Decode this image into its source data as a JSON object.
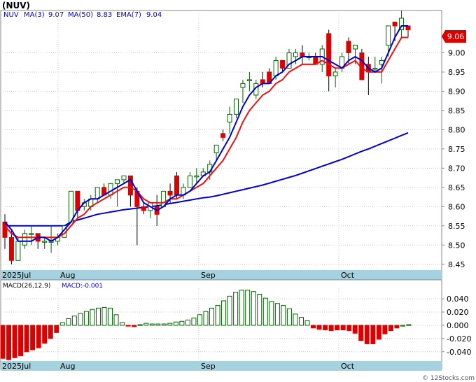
{
  "title": "(NUV)",
  "indicators": {
    "ticker": "NUV",
    "ma3_label": "MA(3)",
    "ma3_value": "9.07",
    "ma50_label": "MA(50)",
    "ma50_value": "8.83",
    "ema7_label": "EMA(7)",
    "ema7_value": "9.04"
  },
  "macd_header": {
    "label": "MACD(26,12,9)",
    "value_label": "MACD:-0.001"
  },
  "price_tag": "9.06",
  "watermark": "© 12Stocks.com",
  "colors": {
    "up": "#006400",
    "down": "#dd0000",
    "ma": "#0000cc",
    "ema": "#ee1111",
    "axis_band": "#a6d1de",
    "tag": "#dd0000"
  },
  "chart_data": [
    {
      "type": "candlestick",
      "x_labels": [
        "2025Jul",
        "Aug",
        "Sep",
        "Oct"
      ],
      "y_ticks": [
        "9.00",
        "8.95",
        "8.90",
        "8.85",
        "8.80",
        "8.75",
        "8.70",
        "8.65",
        "8.60",
        "8.55",
        "8.50",
        "8.45"
      ],
      "ylim": [
        8.435,
        9.11
      ],
      "candles": [
        [
          8.56,
          8.58,
          8.49,
          8.52
        ],
        [
          8.52,
          8.54,
          8.45,
          8.46
        ],
        [
          8.46,
          8.52,
          8.46,
          8.51
        ],
        [
          8.5,
          8.54,
          8.49,
          8.53
        ],
        [
          8.53,
          8.55,
          8.5,
          8.53
        ],
        [
          8.53,
          8.53,
          8.49,
          8.51
        ],
        [
          8.51,
          8.52,
          8.49,
          8.51
        ],
        [
          8.51,
          8.55,
          8.48,
          8.51
        ],
        [
          8.51,
          8.53,
          8.5,
          8.52
        ],
        [
          8.52,
          8.55,
          8.52,
          8.55
        ],
        [
          8.56,
          8.64,
          8.56,
          8.64
        ],
        [
          8.64,
          8.64,
          8.57,
          8.59
        ],
        [
          8.6,
          8.62,
          8.59,
          8.61
        ],
        [
          8.6,
          8.63,
          8.59,
          8.62
        ],
        [
          8.62,
          8.65,
          8.61,
          8.65
        ],
        [
          8.65,
          8.66,
          8.63,
          8.63
        ],
        [
          8.63,
          8.66,
          8.62,
          8.66
        ],
        [
          8.66,
          8.67,
          8.6,
          8.67
        ],
        [
          8.67,
          8.68,
          8.66,
          8.68
        ],
        [
          8.68,
          8.68,
          8.6,
          8.63
        ],
        [
          8.64,
          8.65,
          8.5,
          8.6
        ],
        [
          8.6,
          8.61,
          8.58,
          8.59
        ],
        [
          8.59,
          8.61,
          8.57,
          8.61
        ],
        [
          8.6,
          8.63,
          8.55,
          8.58
        ],
        [
          8.6,
          8.64,
          8.6,
          8.64
        ],
        [
          8.64,
          8.66,
          8.61,
          8.63
        ],
        [
          8.68,
          8.69,
          8.62,
          8.63
        ],
        [
          8.63,
          8.66,
          8.62,
          8.65
        ],
        [
          8.65,
          8.69,
          8.65,
          8.68
        ],
        [
          8.68,
          8.7,
          8.66,
          8.68
        ],
        [
          8.68,
          8.7,
          8.68,
          8.69
        ],
        [
          8.69,
          8.72,
          8.67,
          8.71
        ],
        [
          8.74,
          8.76,
          8.72,
          8.76
        ],
        [
          8.79,
          8.8,
          8.77,
          8.78
        ],
        [
          8.82,
          8.86,
          8.79,
          8.84
        ],
        [
          8.84,
          8.88,
          8.83,
          8.88
        ],
        [
          8.91,
          8.93,
          8.87,
          8.92
        ],
        [
          8.93,
          8.95,
          8.9,
          8.93
        ],
        [
          8.89,
          8.93,
          8.88,
          8.92
        ],
        [
          8.93,
          8.95,
          8.91,
          8.92
        ],
        [
          8.95,
          8.96,
          8.92,
          8.92
        ],
        [
          8.94,
          8.99,
          8.93,
          8.98
        ],
        [
          8.98,
          8.98,
          8.95,
          8.96
        ],
        [
          8.96,
          9.01,
          8.96,
          9.0
        ],
        [
          8.99,
          9.01,
          8.97,
          9.0
        ],
        [
          9.0,
          9.02,
          8.97,
          8.99
        ],
        [
          8.99,
          9.0,
          8.98,
          8.99
        ],
        [
          8.99,
          9.0,
          8.97,
          8.97
        ],
        [
          8.97,
          9.02,
          8.95,
          9.01
        ],
        [
          9.05,
          9.06,
          8.9,
          8.94
        ],
        [
          8.94,
          8.96,
          8.91,
          8.95
        ],
        [
          8.96,
          9.0,
          8.95,
          8.99
        ],
        [
          9.03,
          9.04,
          8.97,
          9.0
        ],
        [
          9.01,
          9.02,
          8.97,
          9.02
        ],
        [
          9.0,
          9.01,
          8.93,
          8.93
        ],
        [
          8.97,
          8.99,
          8.89,
          8.95
        ],
        [
          8.96,
          8.99,
          8.95,
          8.96
        ],
        [
          8.97,
          8.99,
          8.92,
          8.98
        ],
        [
          9.02,
          9.07,
          8.99,
          9.07
        ],
        [
          9.08,
          9.08,
          9.03,
          9.07
        ],
        [
          9.06,
          9.11,
          9.04,
          9.09
        ],
        [
          9.07,
          9.07,
          9.04,
          9.06
        ]
      ],
      "series": [
        {
          "name": "MA(3)",
          "values": [
            8.56,
            8.54,
            8.51,
            8.51,
            8.51,
            8.52,
            8.52,
            8.51,
            8.52,
            8.54,
            8.56,
            8.59,
            8.61,
            8.62,
            8.62,
            8.63,
            8.64,
            8.65,
            8.66,
            8.67,
            8.64,
            8.61,
            8.6,
            8.59,
            8.6,
            8.62,
            8.63,
            8.63,
            8.64,
            8.66,
            8.68,
            8.69,
            8.72,
            8.75,
            8.78,
            8.82,
            8.86,
            8.89,
            8.91,
            8.92,
            8.92,
            8.94,
            8.95,
            8.97,
            8.98,
            8.99,
            8.99,
            8.99,
            8.99,
            8.98,
            8.97,
            8.96,
            8.98,
            8.99,
            8.98,
            8.96,
            8.95,
            8.96,
            9.0,
            9.04,
            9.07,
            9.07
          ]
        },
        {
          "name": "MA(50)",
          "values": [
            8.55,
            8.55,
            8.55,
            8.55,
            8.55,
            8.55,
            8.55,
            8.55,
            8.55,
            8.55,
            8.56,
            8.565,
            8.57,
            8.575,
            8.58,
            8.583,
            8.586,
            8.589,
            8.592,
            8.594,
            8.596,
            8.598,
            8.6,
            8.602,
            8.605,
            8.608,
            8.611,
            8.614,
            8.617,
            8.62,
            8.623,
            8.625,
            8.628,
            8.632,
            8.636,
            8.64,
            8.644,
            8.648,
            8.652,
            8.656,
            8.661,
            8.666,
            8.671,
            8.676,
            8.681,
            8.687,
            8.693,
            8.699,
            8.705,
            8.711,
            8.717,
            8.723,
            8.73,
            8.737,
            8.744,
            8.75,
            8.757,
            8.764,
            8.771,
            8.778,
            8.785,
            8.792
          ]
        },
        {
          "name": "EMA(7)",
          "values": [
            8.55,
            8.53,
            8.52,
            8.52,
            8.52,
            8.52,
            8.52,
            8.52,
            8.52,
            8.53,
            8.55,
            8.57,
            8.58,
            8.6,
            8.61,
            8.62,
            8.63,
            8.64,
            8.65,
            8.65,
            8.64,
            8.62,
            8.61,
            8.61,
            8.61,
            8.62,
            8.62,
            8.63,
            8.64,
            8.65,
            8.66,
            8.68,
            8.7,
            8.72,
            8.75,
            8.78,
            8.82,
            8.85,
            8.87,
            8.89,
            8.9,
            8.92,
            8.93,
            8.95,
            8.96,
            8.97,
            8.97,
            8.97,
            8.98,
            8.97,
            8.96,
            8.96,
            8.97,
            8.98,
            8.96,
            8.95,
            8.95,
            8.95,
            8.98,
            9.01,
            9.04,
            9.04
          ]
        }
      ]
    },
    {
      "type": "bar",
      "title": "MACD(26,12,9)",
      "x_labels": [
        "2025Jul",
        "Aug",
        "Sep",
        "Oct"
      ],
      "y_ticks": [
        "0.040",
        "0.020",
        "0.000",
        "-0.020",
        "-0.040"
      ],
      "ylim": [
        -0.054,
        0.056
      ],
      "values": [
        -0.05,
        -0.052,
        -0.049,
        -0.046,
        -0.04,
        -0.037,
        -0.034,
        -0.027,
        -0.02,
        -0.011,
        0.004,
        0.01,
        0.014,
        0.018,
        0.021,
        0.024,
        0.026,
        0.027,
        0.026,
        0.016,
        0.004,
        -0.001,
        -0.002,
        0.001,
        0.003,
        0.002,
        0.002,
        0.002,
        0.003,
        0.005,
        0.006,
        0.008,
        0.011,
        0.016,
        0.021,
        0.026,
        0.03,
        0.037,
        0.044,
        0.05,
        0.053,
        0.053,
        0.051,
        0.047,
        0.041,
        0.036,
        0.033,
        0.03,
        0.025,
        0.017,
        0.012,
        0.007,
        -0.004,
        -0.006,
        -0.007,
        -0.008,
        -0.007,
        -0.007,
        -0.008,
        -0.012,
        -0.023,
        -0.028,
        -0.028,
        -0.021,
        -0.013,
        -0.008,
        -0.004,
        0.0,
        0.001
      ]
    }
  ]
}
